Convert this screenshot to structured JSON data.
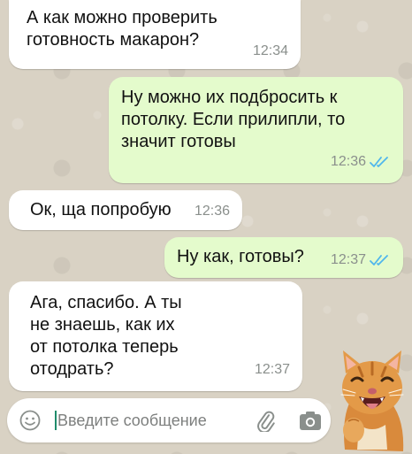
{
  "messages": [
    {
      "direction": "incoming",
      "text": "А как можно проверить\nготовность макарон?",
      "time": "12:34"
    },
    {
      "direction": "outgoing",
      "text": "Ну можно их подбросить к\nпотолку. Если прилипли, то\nзначит готовы",
      "time": "12:36",
      "status": "read"
    },
    {
      "direction": "incoming",
      "text": "Ок, ща попробую",
      "time": "12:36"
    },
    {
      "direction": "outgoing",
      "text": "Ну как, готовы?",
      "time": "12:37",
      "status": "read"
    },
    {
      "direction": "incoming",
      "text": "Ага, спасибо. А ты\nне знаешь, как их\nот потолка теперь\nотодрать?",
      "time": "12:37"
    }
  ],
  "composer": {
    "placeholder": "Введите сообщение",
    "icons": [
      "emoji-icon",
      "paperclip-icon",
      "camera-icon"
    ]
  },
  "colors": {
    "incoming_bubble": "#ffffff",
    "outgoing_bubble": "#e4fbcc",
    "read_ticks": "#4fb6ec",
    "chat_background": "#d9d2c4"
  }
}
